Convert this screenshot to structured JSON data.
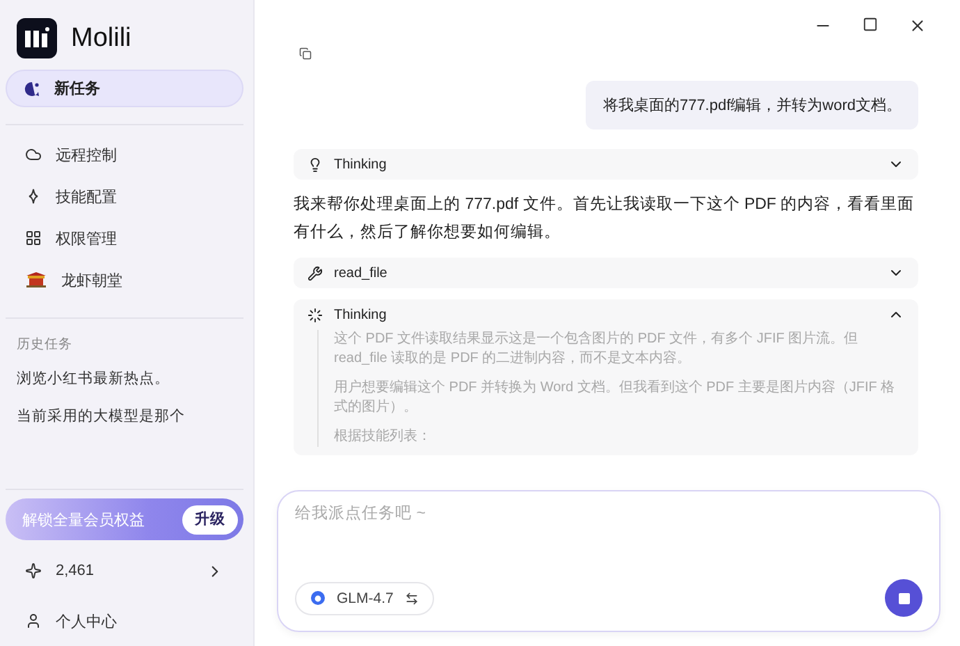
{
  "app": {
    "name": "Molili"
  },
  "sidebar": {
    "new_task": {
      "label": "新任务",
      "selected": true
    },
    "nav_items": [
      {
        "label": "远程控制"
      },
      {
        "label": "技能配置"
      },
      {
        "label": "权限管理"
      },
      {
        "label": "龙虾朝堂"
      }
    ],
    "history": {
      "title": "历史任务",
      "items": [
        {
          "label": "浏览小红书最新热点。"
        },
        {
          "label": "当前采用的大模型是那个"
        }
      ]
    },
    "promo": {
      "text": "解锁全量会员权益",
      "button": "升级"
    },
    "points": "2,461",
    "profile": "个人中心"
  },
  "chat": {
    "messages": [
      {
        "kind": "user",
        "text": "将我桌面的777.pdf编辑，并转为word文档。"
      },
      {
        "kind": "thinking",
        "label": "Thinking",
        "expanded": false
      },
      {
        "kind": "assistant",
        "text": "我来帮你处理桌面上的 777.pdf 文件。首先让我读取一下这个 PDF 的内容，看看里面有什么，然后了解你想要如何编辑。"
      },
      {
        "kind": "tool",
        "label": "read_file",
        "expanded": false
      },
      {
        "kind": "thinking",
        "label": "Thinking",
        "expanded": true,
        "paragraphs": [
          "这个 PDF 文件读取结果显示这是一个包含图片的 PDF 文件，有多个 JFIF 图片流。但 read_file 读取的是 PDF 的二进制内容，而不是文本内容。",
          "用户想要编辑这个 PDF 并转换为 Word 文档。但我看到这个 PDF 主要是图片内容（JFIF 格式的图片）。",
          "根据技能列表："
        ]
      }
    ]
  },
  "composer": {
    "placeholder": "给我派点任务吧 ~",
    "model": "GLM-4.7"
  }
}
